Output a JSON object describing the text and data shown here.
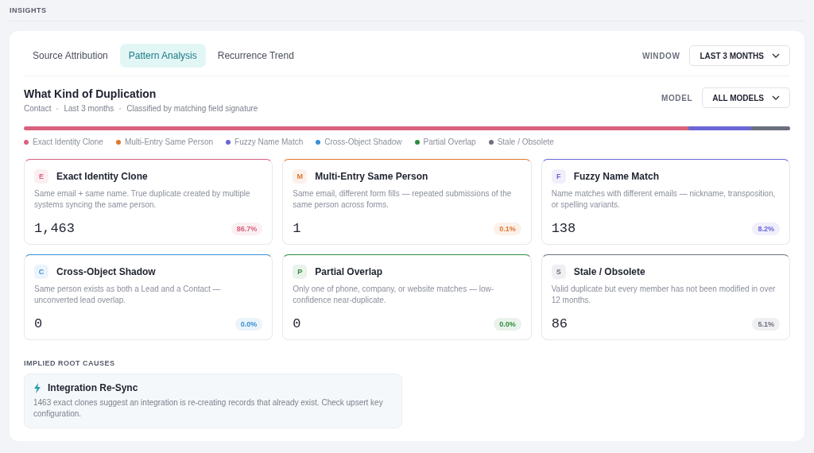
{
  "header": {
    "title": "INSIGHTS"
  },
  "tabs": [
    {
      "label": "Source Attribution",
      "selected": false
    },
    {
      "label": "Pattern Analysis",
      "selected": true
    },
    {
      "label": "Recurrence Trend",
      "selected": false
    }
  ],
  "window_filter": {
    "label": "WINDOW",
    "value": "LAST 3 MONTHS"
  },
  "section": {
    "title": "What Kind of Duplication",
    "meta": [
      "Contact",
      "Last 3 months",
      "Classified by matching field signature"
    ]
  },
  "model_filter": {
    "label": "MODEL",
    "value": "ALL MODELS"
  },
  "legend": [
    {
      "label": "Exact Identity Clone",
      "color": "#d9617f"
    },
    {
      "label": "Multi-Entry Same Person",
      "color": "#e0782f"
    },
    {
      "label": "Fuzzy Name Match",
      "color": "#6b66d6"
    },
    {
      "label": "Cross-Object Shadow",
      "color": "#3a8fd6"
    },
    {
      "label": "Partial Overlap",
      "color": "#2e8b3e"
    },
    {
      "label": "Stale / Obsolete",
      "color": "#6b7080"
    }
  ],
  "cards": [
    {
      "letter": "E",
      "title": "Exact Identity Clone",
      "description": "Same email + same name. True duplicate created by multiple systems syncing the same person.",
      "count": "1,463",
      "percent": "86.7%",
      "color": "#d9617f"
    },
    {
      "letter": "M",
      "title": "Multi-Entry Same Person",
      "description": "Same email, different form fills — repeated submissions of the same person across forms.",
      "count": "1",
      "percent": "0.1%",
      "color": "#e0782f"
    },
    {
      "letter": "F",
      "title": "Fuzzy Name Match",
      "description": "Name matches with different emails — nickname, transposition, or spelling variants.",
      "count": "138",
      "percent": "8.2%",
      "color": "#6b66d6"
    },
    {
      "letter": "C",
      "title": "Cross-Object Shadow",
      "description": "Same person exists as both a Lead and a Contact — unconverted lead overlap.",
      "count": "0",
      "percent": "0.0%",
      "color": "#3a8fd6"
    },
    {
      "letter": "P",
      "title": "Partial Overlap",
      "description": "Only one of phone, company, or website matches — low-confidence near-duplicate.",
      "count": "0",
      "percent": "0.0%",
      "color": "#2e8b3e"
    },
    {
      "letter": "S",
      "title": "Stale / Obsolete",
      "description": "Valid duplicate but every member has not been modified in over 12 months.",
      "count": "86",
      "percent": "5.1%",
      "color": "#6b7080"
    }
  ],
  "root_causes": {
    "title": "IMPLIED ROOT CAUSES",
    "items": [
      {
        "title": "Integration Re-Sync",
        "description": "1463 exact clones suggest an integration is re-creating records that already exist. Check upsert key configuration."
      }
    ]
  }
}
